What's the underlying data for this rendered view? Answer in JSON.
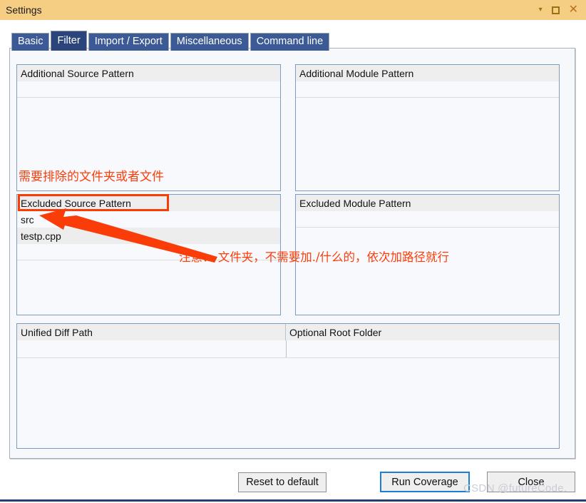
{
  "window": {
    "title": "Settings",
    "controls": [
      {
        "name": "chevron-down-icon",
        "glyph": "▾"
      },
      {
        "name": "maximize-icon",
        "glyph": ""
      },
      {
        "name": "close-icon",
        "glyph": "✕"
      }
    ]
  },
  "tabs": [
    {
      "id": "basic",
      "label": "Basic",
      "active": false
    },
    {
      "id": "filter",
      "label": "Filter",
      "active": true
    },
    {
      "id": "import-export",
      "label": "Import / Export",
      "active": false
    },
    {
      "id": "miscellaneous",
      "label": "Miscellaneous",
      "active": false
    },
    {
      "id": "command-line",
      "label": "Command line",
      "active": false
    }
  ],
  "panels": {
    "additional_source": {
      "header": "Additional Source Pattern",
      "rows": []
    },
    "additional_module": {
      "header": "Additional Module Pattern",
      "rows": []
    },
    "excluded_source": {
      "header": "Excluded Source Pattern",
      "rows": [
        "src",
        "testp.cpp"
      ]
    },
    "excluded_module": {
      "header": "Excluded Module Pattern",
      "rows": []
    },
    "diff": {
      "header_left": "Unified Diff Path",
      "header_right": "Optional Root Folder",
      "value_left": "",
      "value_right": ""
    }
  },
  "buttons": {
    "reset": "Reset to default",
    "run": "Run Coverage",
    "close": "Close"
  },
  "annotations": {
    "note_top": "需要排除的文件夹或者文件",
    "note_bottom": "注意： 文件夹，不需要加./什么的，依次加路径就行",
    "color": "#fc3d0a"
  },
  "watermark": "CSDN @futureCode.",
  "colors": {
    "titlebar": "#f5ce84",
    "tab": "#3c5a96",
    "tab_active": "#2b457c",
    "panel_header": "#eeeeee",
    "panel_bg": "#f7f9fc",
    "row_alt": "#ededed",
    "focus_border": "#1a7fd4",
    "annotation": "#fc3d0a",
    "bottom_rule": "#24406e"
  }
}
